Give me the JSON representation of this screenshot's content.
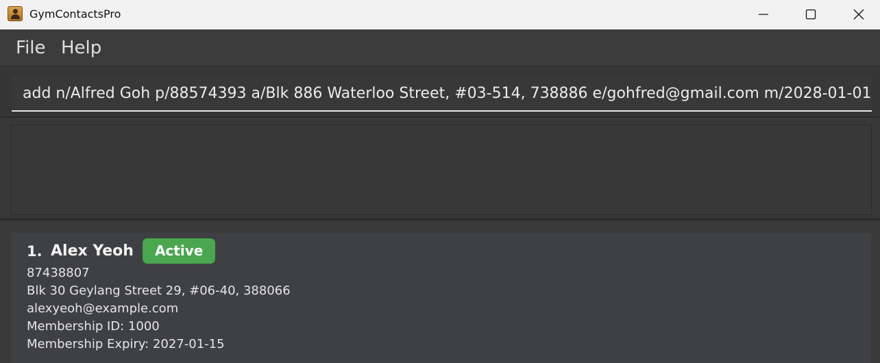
{
  "window": {
    "title": "GymContactsPro",
    "icon": "contacts-book-icon",
    "controls": [
      "minimize-icon",
      "maximize-icon",
      "close-icon"
    ]
  },
  "menu": {
    "items": [
      {
        "label": "File"
      },
      {
        "label": "Help"
      }
    ]
  },
  "command": {
    "value": "add n/Alfred Goh p/88574393 a/Blk 886 Waterloo Street, #03-514, 738886 e/gohfred@gmail.com m/2028-01-01"
  },
  "result": {
    "text": ""
  },
  "persons": [
    {
      "index": "1.",
      "name": "Alex Yeoh",
      "status": "Active",
      "phone": "87438807",
      "address": "Blk 30 Geylang Street 29, #06-40, 388066",
      "email": "alexyeoh@example.com",
      "membership_id": "Membership ID: 1000",
      "membership_expiry": "Membership Expiry: 2027-01-15"
    }
  ],
  "colors": {
    "background": "#3a3a3a",
    "card": "#3f4043",
    "active_badge": "#4aa64f",
    "titlebar": "#f2f2f2"
  }
}
